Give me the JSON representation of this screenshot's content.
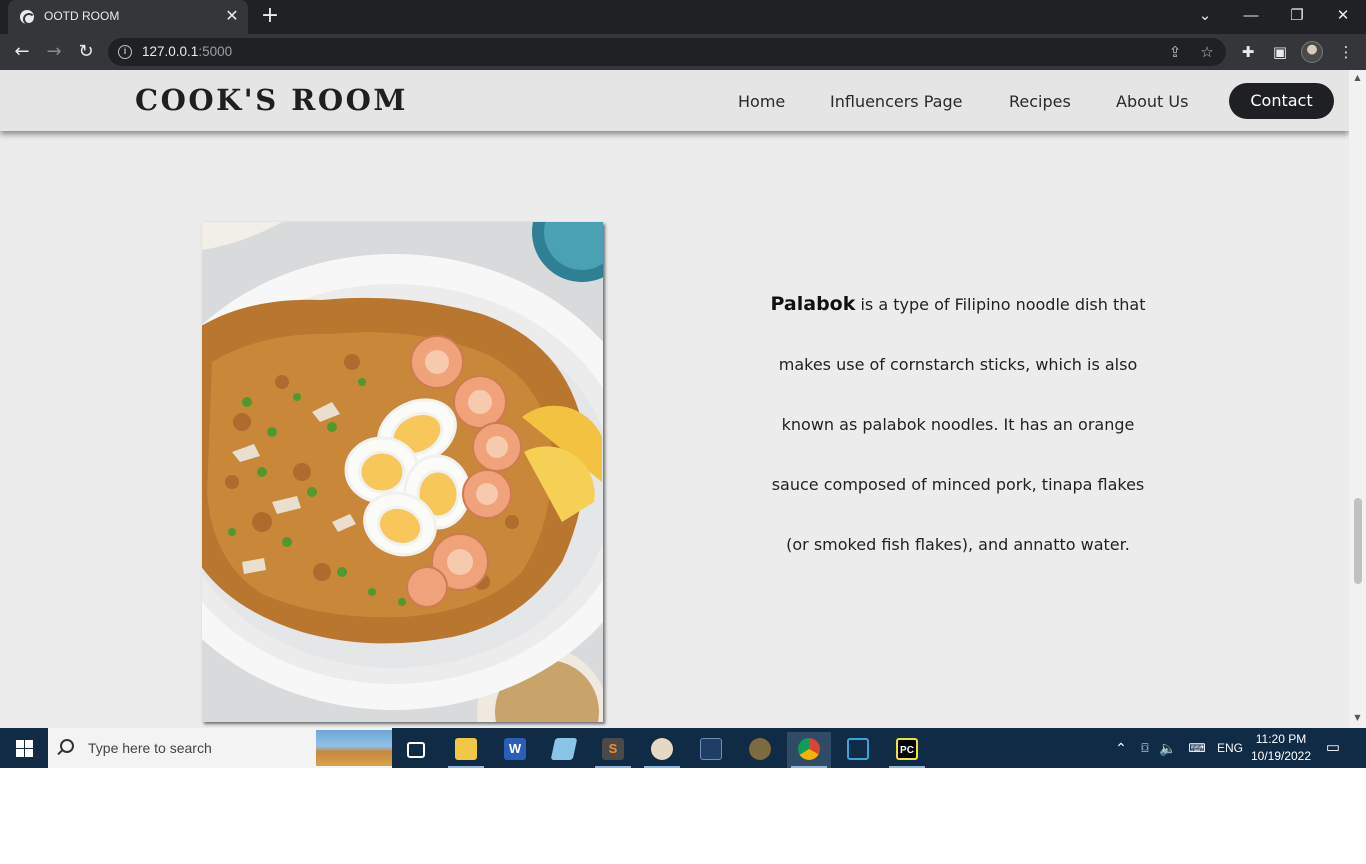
{
  "browser": {
    "tab_title": "OOTD ROOM",
    "tab_close": "✕",
    "new_tab": "+",
    "url_host": "127.0.0.1",
    "url_port": ":5000",
    "window_controls": {
      "tab_search": "⌄",
      "minimize": "—",
      "restore": "❐",
      "close": "✕"
    },
    "nav": {
      "back": "←",
      "forward": "→",
      "reload": "↻"
    },
    "icons": {
      "share": "⇪",
      "star": "☆",
      "extensions": "✚",
      "side_panel": "▣",
      "menu": "⋮"
    }
  },
  "site": {
    "logo": "COOK'S ROOM",
    "nav": [
      "Home",
      "Influencers Page",
      "Recipes",
      "About Us"
    ],
    "contact": "Contact"
  },
  "article": {
    "dish_name": "Palabok",
    "description": " is a type of Filipino noodle dish that makes use of cornstarch sticks, which is also known as palabok noodles. It has an orange sauce composed of minced pork, tinapa flakes (or smoked fish flakes), and annatto water."
  },
  "taskbar": {
    "search_placeholder": "Type here to search",
    "apps": [
      "task-view",
      "file-explorer",
      "word",
      "notepad",
      "sublime-text",
      "paint",
      "mysql-workbench",
      "sql-tool",
      "chrome",
      "virtualbox",
      "pycharm"
    ],
    "tray": {
      "chevron": "⌃",
      "language": "ENG"
    },
    "time": "11:20 PM",
    "date": "10/19/2022"
  },
  "colors": {
    "header_bg": "#e5e5e5",
    "page_bg": "#ececec",
    "contact_bg": "#1f2024",
    "taskbar_bg": "#0f2b46"
  }
}
